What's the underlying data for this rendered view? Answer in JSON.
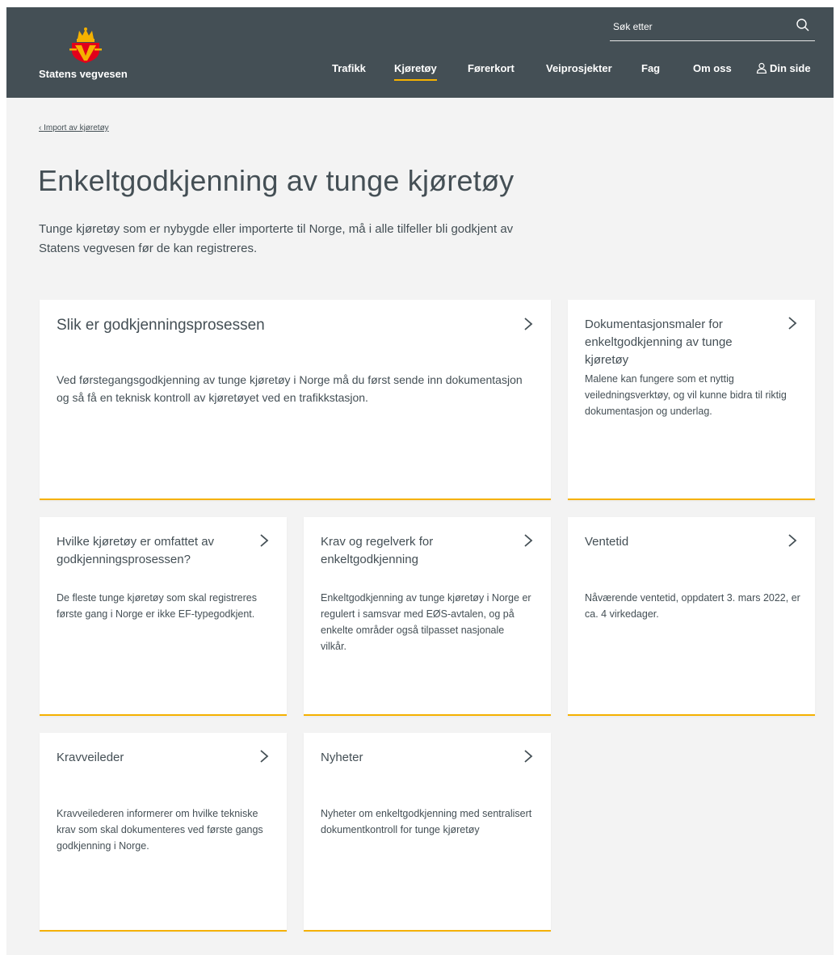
{
  "brand": {
    "name": "Statens vegvesen",
    "logo_icon": "crown-shield-logo",
    "colors": {
      "header": "#444f55",
      "accent": "#f5b100",
      "logo_red": "#e2001a",
      "logo_yellow": "#f5b100"
    }
  },
  "search": {
    "placeholder": "Søk etter",
    "icon": "search-icon"
  },
  "nav": {
    "items": [
      {
        "label": "Trafikk"
      },
      {
        "label": "Kjøretøy",
        "active": true
      },
      {
        "label": "Førerkort"
      },
      {
        "label": "Veiprosjekter"
      },
      {
        "label": "Fag"
      },
      {
        "label": "Om oss"
      }
    ],
    "user": {
      "label": "Din side",
      "icon": "user-icon"
    }
  },
  "breadcrumb": {
    "label": "Import av kjøretøy",
    "icon": "chevron-left-icon"
  },
  "page": {
    "title": "Enkeltgodkjenning av tunge kjøretøy",
    "ingress": "Tunge kjøretøy som er nybygde eller importerte til Norge, må i alle tilfeller bli godkjent av Statens vegvesen før de kan registreres."
  },
  "cards": [
    {
      "title": "Slik er godkjenningsprosessen",
      "description": "Ved førstegangsgodkjenning av tunge kjøretøy i Norge må du først sende inn dokumentasjon og så få en teknisk kontroll av kjøretøyet ved en trafikkstasjon."
    },
    {
      "title": "Dokumentasjonsmaler for enkeltgodkjenning av tunge kjøretøy",
      "description": "Malene kan fungere som et nyttig veiledningsverktøy, og vil kunne bidra til riktig dokumentasjon og underlag."
    },
    {
      "title": "Hvilke kjøretøy er omfattet av godkjenningsprosessen?",
      "description": "De fleste tunge kjøretøy som skal registreres første gang i Norge er ikke EF-typegodkjent."
    },
    {
      "title": "Krav og regelverk for enkeltgodkjenning",
      "description": "Enkeltgodkjenning av tunge kjøretøy i Norge er regulert i samsvar med EØS-avtalen, og på enkelte områder også tilpasset nasjonale vilkår."
    },
    {
      "title": "Ventetid",
      "description": "Nåværende ventetid, oppdatert 3. mars 2022, er ca. 4 virkedager."
    },
    {
      "title": "Kravveileder",
      "description": "Kravveilederen informerer om hvilke tekniske krav som skal dokumenteres ved første gangs godkjenning i Norge."
    },
    {
      "title": "Nyheter",
      "description": "Nyheter om enkeltgodkjenning med sentralisert dokumentkontroll for tunge kjøretøy"
    }
  ]
}
